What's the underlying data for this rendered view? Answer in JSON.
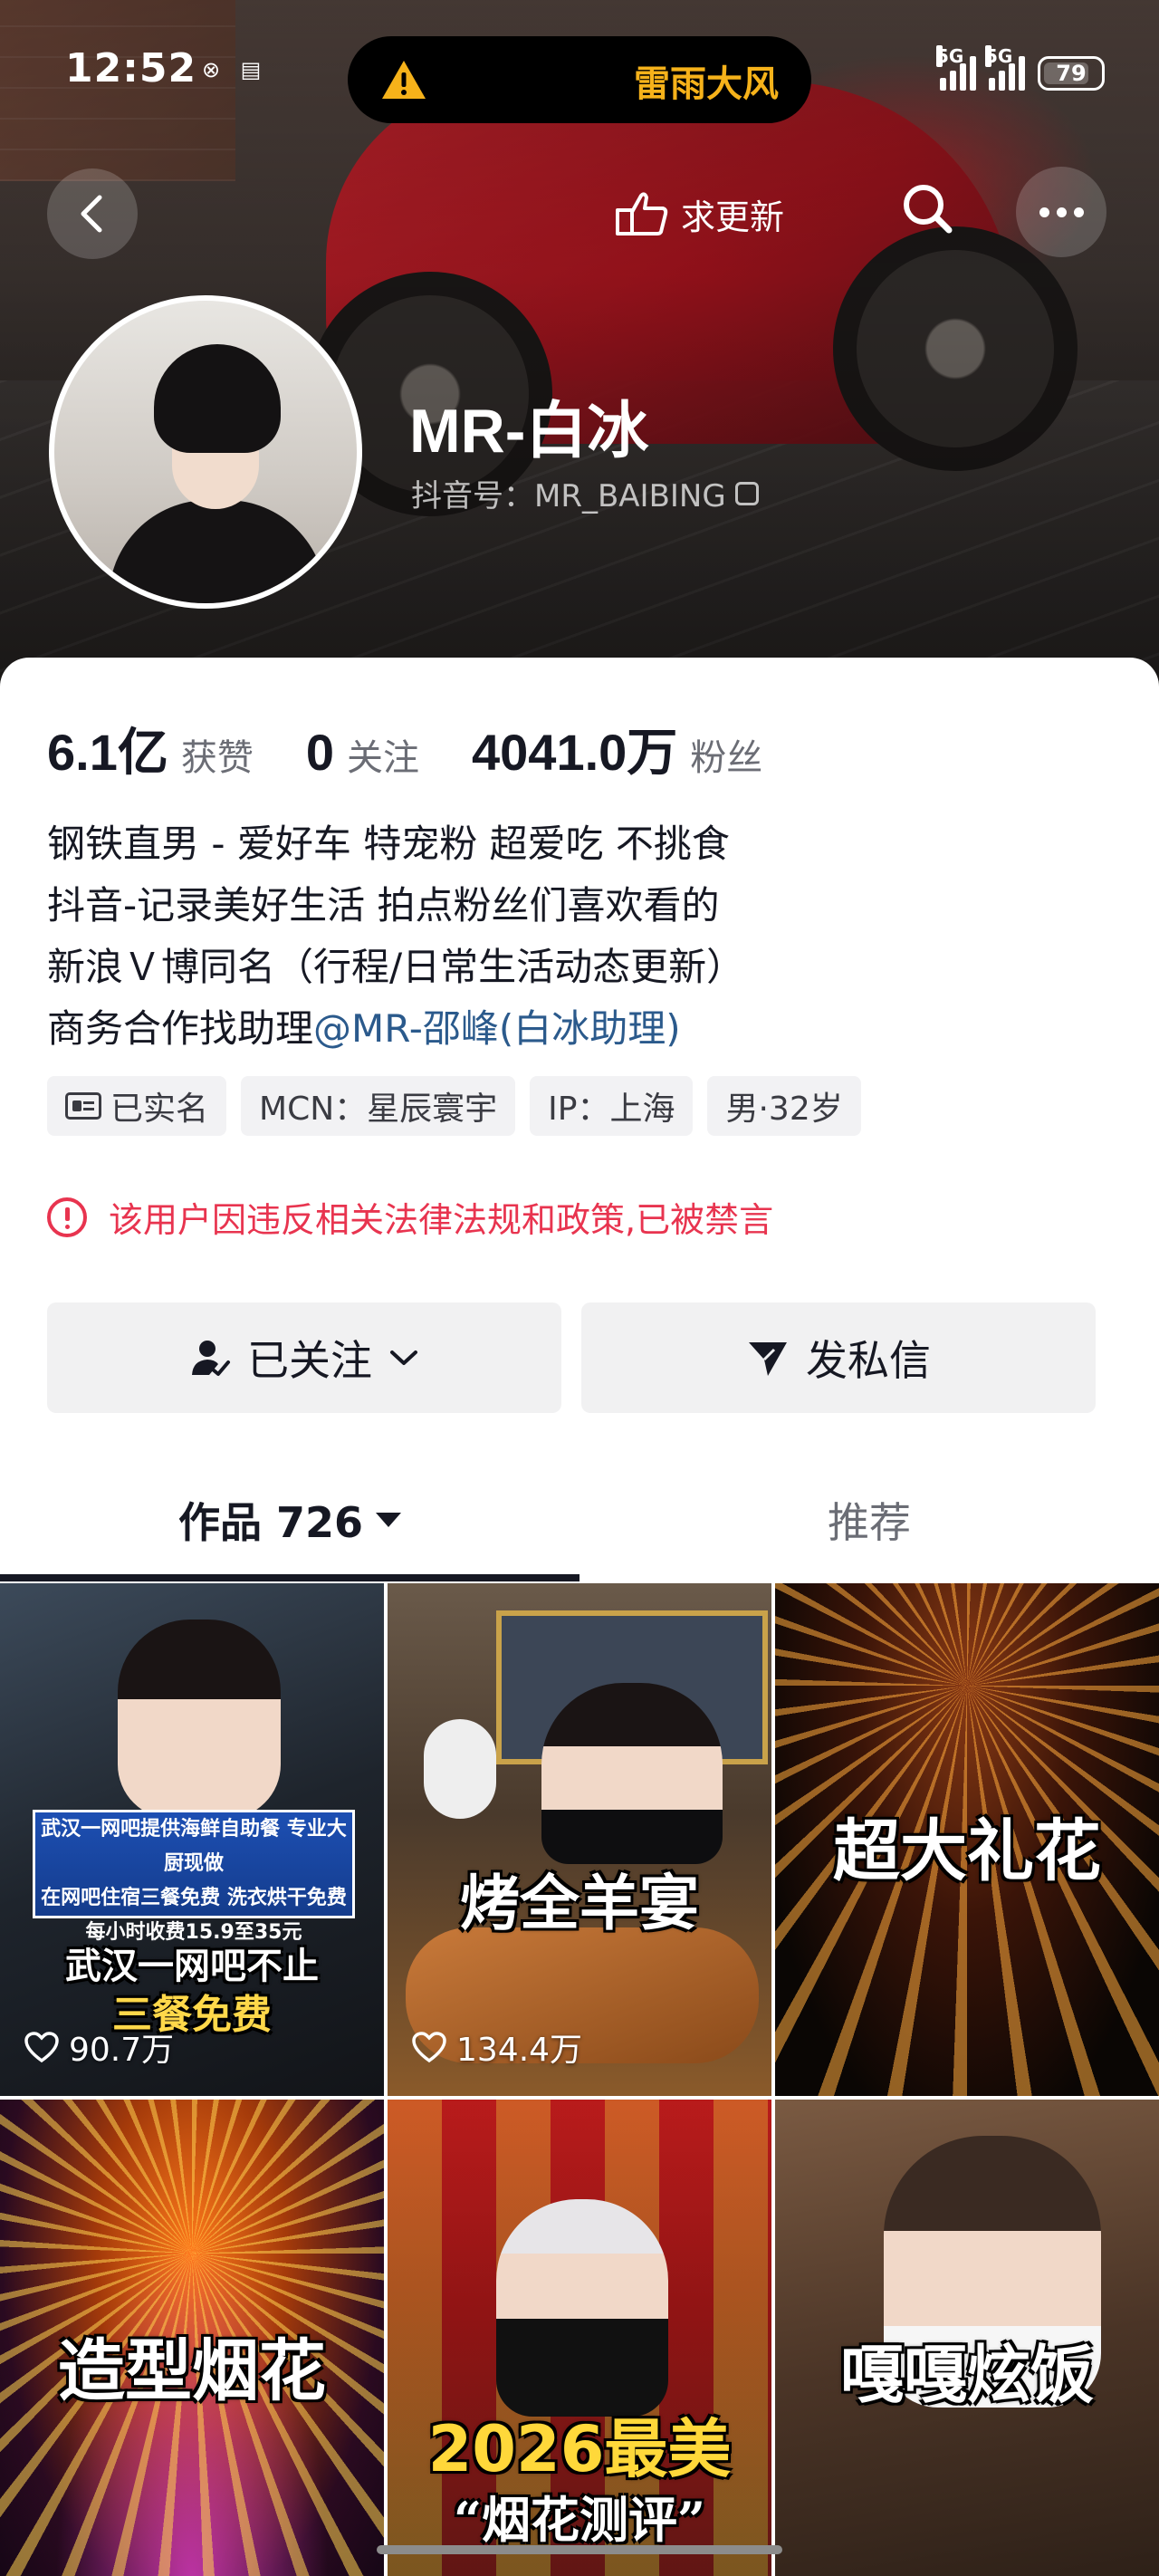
{
  "status_bar": {
    "time": "12:52",
    "island_alert": "雷雨大风",
    "network_1": "5G",
    "network_2": "5G",
    "battery": "79",
    "battery_level": 0.79,
    "alert_color": "#f6b21a",
    "battery_color": "#ffffff"
  },
  "nav": {
    "back_icon": "chevron-left-icon",
    "request_update_icon": "pointing-hand-icon",
    "request_update": "求更新",
    "search_icon": "search-icon",
    "more_icon": "more-horizontal-icon"
  },
  "profile": {
    "name": "MR-白冰",
    "douyin_id": "抖音号：MR_BAIBING",
    "copy_icon": "copy-icon"
  },
  "stats": [
    {
      "value": "6.1亿",
      "label": "获赞"
    },
    {
      "value": "0",
      "label": "关注"
    },
    {
      "value": "4041.0万",
      "label": "粉丝"
    }
  ],
  "bio": {
    "line1": "钢铁直男 - 爱好车 特宠粉 超爱吃 不挑食",
    "line2": "抖音-记录美好生活 拍点粉丝们喜欢看的",
    "line3": "新浪Ｖ博同名（行程/日常生活动态更新）",
    "line4_prefix": "商务合作找助理",
    "line4_mention": "@MR-邵峰(白冰助理)",
    "mention_color": "#2b5a8c"
  },
  "tags": {
    "verified": "已实名",
    "mcn": "MCN：星辰寰宇",
    "ip": "IP：上海",
    "gender_age": "男·32岁"
  },
  "ban_notice": {
    "text": "该用户因违反相关法律法规和政策,已被禁言",
    "color": "#e8344f"
  },
  "actions": {
    "follow": "已关注",
    "message": "发私信"
  },
  "tabs": {
    "works": "作品 726",
    "recommend": "推荐"
  },
  "videos": [
    {
      "banner_l1": "武汉一网吧提供海鲜自助餐 专业大厨现做",
      "banner_l2": "在网吧住宿三餐免费 洗衣烘干免费",
      "banner_l3": "每小时收费15.9至35元",
      "caption_a": "武汉一网吧不止",
      "caption_b": "三餐免费",
      "likes": "90.7万"
    },
    {
      "caption_a": "烤全羊宴",
      "likes": "134.4万"
    },
    {
      "caption_a": "超大礼花"
    },
    {
      "caption_a": "造型烟花"
    },
    {
      "caption_a": "2026最美",
      "caption_b": "“烟花测评”"
    },
    {
      "caption_a": "嘎嘎炫饭"
    }
  ]
}
